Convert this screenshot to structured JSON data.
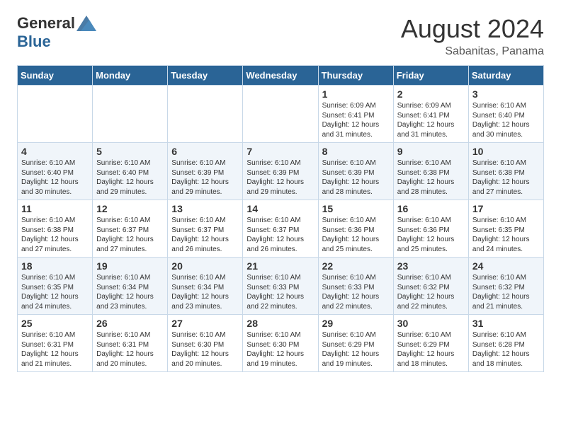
{
  "header": {
    "logo_general": "General",
    "logo_blue": "Blue",
    "month_year": "August 2024",
    "location": "Sabanitas, Panama"
  },
  "weekdays": [
    "Sunday",
    "Monday",
    "Tuesday",
    "Wednesday",
    "Thursday",
    "Friday",
    "Saturday"
  ],
  "weeks": [
    [
      {
        "day": "",
        "info": ""
      },
      {
        "day": "",
        "info": ""
      },
      {
        "day": "",
        "info": ""
      },
      {
        "day": "",
        "info": ""
      },
      {
        "day": "1",
        "info": "Sunrise: 6:09 AM\nSunset: 6:41 PM\nDaylight: 12 hours\nand 31 minutes."
      },
      {
        "day": "2",
        "info": "Sunrise: 6:09 AM\nSunset: 6:41 PM\nDaylight: 12 hours\nand 31 minutes."
      },
      {
        "day": "3",
        "info": "Sunrise: 6:10 AM\nSunset: 6:40 PM\nDaylight: 12 hours\nand 30 minutes."
      }
    ],
    [
      {
        "day": "4",
        "info": "Sunrise: 6:10 AM\nSunset: 6:40 PM\nDaylight: 12 hours\nand 30 minutes."
      },
      {
        "day": "5",
        "info": "Sunrise: 6:10 AM\nSunset: 6:40 PM\nDaylight: 12 hours\nand 29 minutes."
      },
      {
        "day": "6",
        "info": "Sunrise: 6:10 AM\nSunset: 6:39 PM\nDaylight: 12 hours\nand 29 minutes."
      },
      {
        "day": "7",
        "info": "Sunrise: 6:10 AM\nSunset: 6:39 PM\nDaylight: 12 hours\nand 29 minutes."
      },
      {
        "day": "8",
        "info": "Sunrise: 6:10 AM\nSunset: 6:39 PM\nDaylight: 12 hours\nand 28 minutes."
      },
      {
        "day": "9",
        "info": "Sunrise: 6:10 AM\nSunset: 6:38 PM\nDaylight: 12 hours\nand 28 minutes."
      },
      {
        "day": "10",
        "info": "Sunrise: 6:10 AM\nSunset: 6:38 PM\nDaylight: 12 hours\nand 27 minutes."
      }
    ],
    [
      {
        "day": "11",
        "info": "Sunrise: 6:10 AM\nSunset: 6:38 PM\nDaylight: 12 hours\nand 27 minutes."
      },
      {
        "day": "12",
        "info": "Sunrise: 6:10 AM\nSunset: 6:37 PM\nDaylight: 12 hours\nand 27 minutes."
      },
      {
        "day": "13",
        "info": "Sunrise: 6:10 AM\nSunset: 6:37 PM\nDaylight: 12 hours\nand 26 minutes."
      },
      {
        "day": "14",
        "info": "Sunrise: 6:10 AM\nSunset: 6:37 PM\nDaylight: 12 hours\nand 26 minutes."
      },
      {
        "day": "15",
        "info": "Sunrise: 6:10 AM\nSunset: 6:36 PM\nDaylight: 12 hours\nand 25 minutes."
      },
      {
        "day": "16",
        "info": "Sunrise: 6:10 AM\nSunset: 6:36 PM\nDaylight: 12 hours\nand 25 minutes."
      },
      {
        "day": "17",
        "info": "Sunrise: 6:10 AM\nSunset: 6:35 PM\nDaylight: 12 hours\nand 24 minutes."
      }
    ],
    [
      {
        "day": "18",
        "info": "Sunrise: 6:10 AM\nSunset: 6:35 PM\nDaylight: 12 hours\nand 24 minutes."
      },
      {
        "day": "19",
        "info": "Sunrise: 6:10 AM\nSunset: 6:34 PM\nDaylight: 12 hours\nand 23 minutes."
      },
      {
        "day": "20",
        "info": "Sunrise: 6:10 AM\nSunset: 6:34 PM\nDaylight: 12 hours\nand 23 minutes."
      },
      {
        "day": "21",
        "info": "Sunrise: 6:10 AM\nSunset: 6:33 PM\nDaylight: 12 hours\nand 22 minutes."
      },
      {
        "day": "22",
        "info": "Sunrise: 6:10 AM\nSunset: 6:33 PM\nDaylight: 12 hours\nand 22 minutes."
      },
      {
        "day": "23",
        "info": "Sunrise: 6:10 AM\nSunset: 6:32 PM\nDaylight: 12 hours\nand 22 minutes."
      },
      {
        "day": "24",
        "info": "Sunrise: 6:10 AM\nSunset: 6:32 PM\nDaylight: 12 hours\nand 21 minutes."
      }
    ],
    [
      {
        "day": "25",
        "info": "Sunrise: 6:10 AM\nSunset: 6:31 PM\nDaylight: 12 hours\nand 21 minutes."
      },
      {
        "day": "26",
        "info": "Sunrise: 6:10 AM\nSunset: 6:31 PM\nDaylight: 12 hours\nand 20 minutes."
      },
      {
        "day": "27",
        "info": "Sunrise: 6:10 AM\nSunset: 6:30 PM\nDaylight: 12 hours\nand 20 minutes."
      },
      {
        "day": "28",
        "info": "Sunrise: 6:10 AM\nSunset: 6:30 PM\nDaylight: 12 hours\nand 19 minutes."
      },
      {
        "day": "29",
        "info": "Sunrise: 6:10 AM\nSunset: 6:29 PM\nDaylight: 12 hours\nand 19 minutes."
      },
      {
        "day": "30",
        "info": "Sunrise: 6:10 AM\nSunset: 6:29 PM\nDaylight: 12 hours\nand 18 minutes."
      },
      {
        "day": "31",
        "info": "Sunrise: 6:10 AM\nSunset: 6:28 PM\nDaylight: 12 hours\nand 18 minutes."
      }
    ]
  ]
}
